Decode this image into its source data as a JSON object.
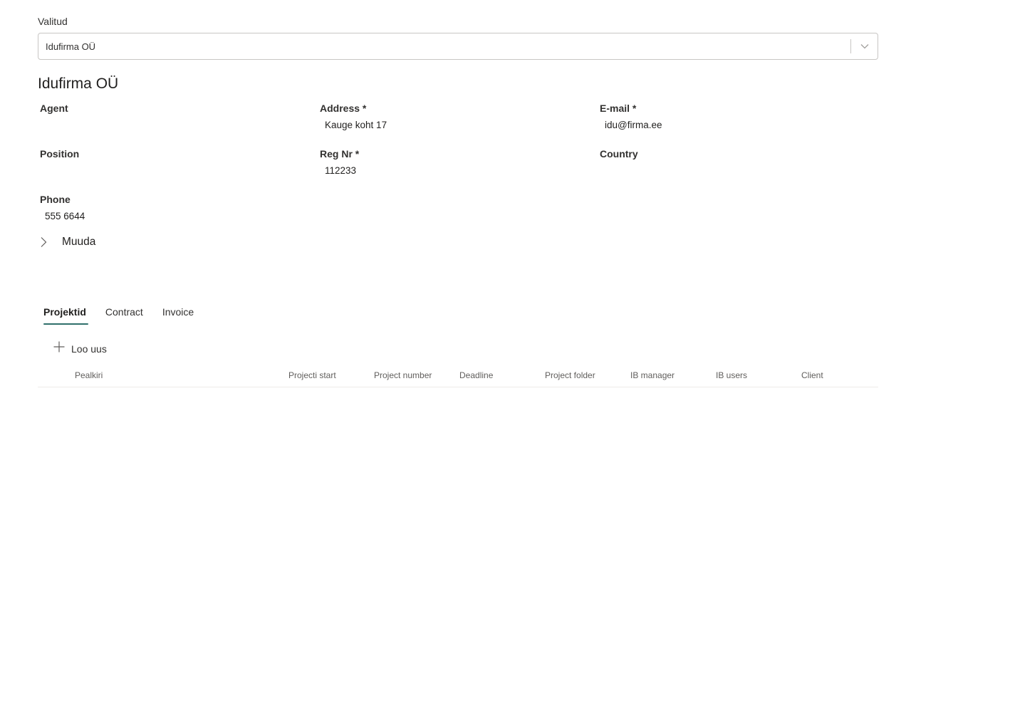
{
  "selector": {
    "label": "Valitud",
    "value": "Idufirma OÜ"
  },
  "record": {
    "title": "Idufirma OÜ"
  },
  "fields": {
    "agent": {
      "label": "Agent",
      "value": ""
    },
    "address": {
      "label": "Address *",
      "value": "Kauge koht 17"
    },
    "email": {
      "label": "E-mail *",
      "value": "idu@firma.ee"
    },
    "position": {
      "label": "Position",
      "value": ""
    },
    "regnr": {
      "label": "Reg Nr *",
      "value": "112233"
    },
    "country": {
      "label": "Country",
      "value": ""
    },
    "phone": {
      "label": "Phone",
      "value": "555 6644"
    }
  },
  "expander": {
    "label": "Muuda",
    "icon": "chevron-right-icon"
  },
  "tabs": [
    {
      "label": "Projektid",
      "active": true
    },
    {
      "label": "Contract",
      "active": false
    },
    {
      "label": "Invoice",
      "active": false
    }
  ],
  "toolbar": {
    "new_label": "Loo uus",
    "new_icon": "plus-icon"
  },
  "grid": {
    "columns": [
      "Pealkiri",
      "Projecti start",
      "Project number",
      "Deadline",
      "Project folder",
      "IB manager",
      "IB users",
      "Client"
    ],
    "rows": []
  },
  "colors": {
    "accent": "#2f6f6b",
    "border": "#c8c6c4",
    "divider": "#edebe9"
  }
}
